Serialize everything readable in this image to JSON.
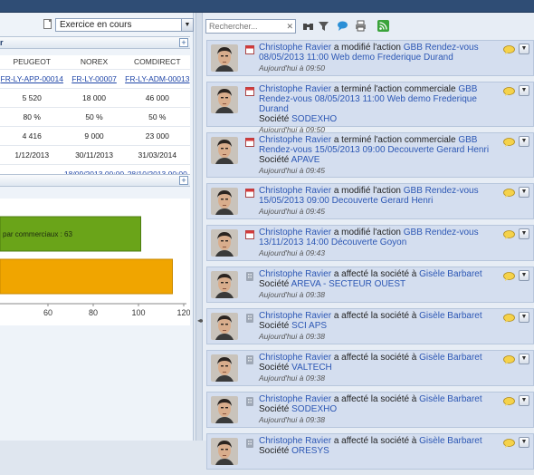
{
  "left": {
    "exercise_select": "Exercice en cours",
    "panel1_title": "r",
    "table": {
      "headers": [
        "PEUGEOT",
        "NOREX",
        "COMDIRECT"
      ],
      "rows": [
        [
          "FR-LY-APP-00014",
          "FR-LY-00007",
          "FR-LY-ADM-00013"
        ],
        [
          "5 520",
          "18 000",
          "46 000"
        ],
        [
          "80 %",
          "50 %",
          "50 %"
        ],
        [
          "4 416",
          "9 000",
          "23 000"
        ],
        [
          "1/12/2013",
          "30/11/2013",
          "31/03/2014"
        ],
        [
          "",
          "18/09/2013 00:00",
          "28/10/2013 00:00"
        ]
      ]
    },
    "chart_label": "par commerciaux : 63"
  },
  "chart_data": {
    "type": "bar",
    "orientation": "horizontal",
    "categories": [
      "",
      ""
    ],
    "values": [
      101,
      115
    ],
    "colors": [
      "#6aa419",
      "#f0a500"
    ],
    "xticks": [
      "60",
      "80",
      "100",
      "120"
    ],
    "xlim": [
      40,
      120
    ],
    "labels": [
      "par commerciaux : 63",
      ""
    ]
  },
  "right": {
    "search_placeholder": "Rechercher...",
    "items": [
      {
        "actor": "Christophe Ravier",
        "mid": " a modifié l'action ",
        "target": "GBB Rendez-vous 08/05/2013 11:00 Web demo Frederique Durand",
        "societe_label": "",
        "societe": "",
        "time": "Aujourd'hui à 09:50",
        "icon": "calendar"
      },
      {
        "actor": "Christophe Ravier",
        "mid": " a terminé l'action commerciale ",
        "target": "GBB Rendez-vous 08/05/2013 11:00 Web demo Frederique Durand",
        "societe_label": "Société ",
        "societe": "SODEXHO",
        "time": "Aujourd'hui à 09:50",
        "icon": "calendar"
      },
      {
        "actor": "Christophe Ravier",
        "mid": " a terminé l'action commerciale ",
        "target": "GBB Rendez-vous 15/05/2013 09:00 Decouverte Gerard Henri",
        "societe_label": "Société ",
        "societe": "APAVE",
        "time": "Aujourd'hui à 09:45",
        "icon": "calendar"
      },
      {
        "actor": "Christophe Ravier",
        "mid": " a modifié l'action ",
        "target": "GBB Rendez-vous 15/05/2013 09:00 Decouverte Gerard Henri",
        "societe_label": "",
        "societe": "",
        "time": "Aujourd'hui à 09:45",
        "icon": "calendar"
      },
      {
        "actor": "Christophe Ravier",
        "mid": " a modifié l'action ",
        "target": "GBB Rendez-vous 13/11/2013 14:00 Découverte Goyon",
        "societe_label": "",
        "societe": "",
        "time": "Aujourd'hui à 09:43",
        "icon": "calendar"
      },
      {
        "actor": "Christophe Ravier",
        "mid": " a affecté la société à ",
        "target": "Gisèle Barbaret",
        "societe_label": "Société ",
        "societe": "AREVA - SECTEUR OUEST",
        "time": "Aujourd'hui à 09:38",
        "icon": "building"
      },
      {
        "actor": "Christophe Ravier",
        "mid": " a affecté la société à ",
        "target": "Gisèle Barbaret",
        "societe_label": "Société ",
        "societe": "SCI APS",
        "time": "Aujourd'hui à 09:38",
        "icon": "building"
      },
      {
        "actor": "Christophe Ravier",
        "mid": " a affecté la société à ",
        "target": "Gisèle Barbaret",
        "societe_label": "Société ",
        "societe": "VALTECH",
        "time": "Aujourd'hui à 09:38",
        "icon": "building"
      },
      {
        "actor": "Christophe Ravier",
        "mid": " a affecté la société à ",
        "target": "Gisèle Barbaret",
        "societe_label": "Société ",
        "societe": "SODEXHO",
        "time": "Aujourd'hui à 09:38",
        "icon": "building"
      },
      {
        "actor": "Christophe Ravier",
        "mid": " a affecté la société à ",
        "target": "Gisèle Barbaret",
        "societe_label": "Société ",
        "societe": "ORESYS",
        "time": "",
        "icon": "building"
      }
    ]
  }
}
